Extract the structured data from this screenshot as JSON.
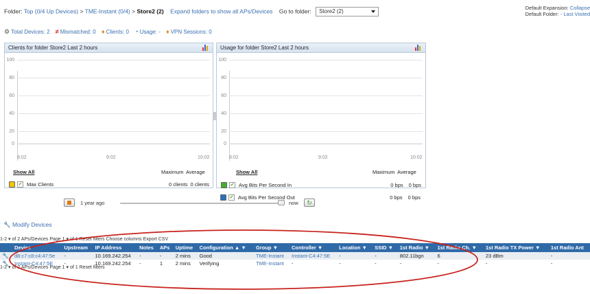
{
  "folder": {
    "label": "Folder:",
    "crumb_top": "Top (0/4 Up Devices)",
    "sep1": ">",
    "crumb_mid": "TME-Instant (0/4)",
    "sep2": ">",
    "current": "Store2 (2)",
    "expand_link": "Expand folders to show all APs/Devices",
    "goto_label": "Go to folder:",
    "goto_value": "Store2 (2)"
  },
  "defaults": {
    "expansion_label": "Default Expansion:",
    "expansion_value": "Collapse",
    "folder_label": "Default Folder:",
    "folder_value": "- Last Visited"
  },
  "stats": {
    "total": "Total Devices: 2",
    "mismatched": "Mismatched: 0",
    "clients": "Clients: 0",
    "usage": "Usage: -",
    "vpn": "VPN Sessions: 0"
  },
  "clients_panel": {
    "title": "Clients for folder Store2   Last 2 hours",
    "y_ticks": [
      "100",
      "80",
      "60",
      "40",
      "20",
      "0"
    ],
    "x_ticks": [
      "8:02",
      "9:02",
      "10:02"
    ],
    "show_all": "Show All",
    "col_max": "Maximum",
    "col_avg": "Average",
    "series": [
      {
        "name": "Max Clients",
        "max": "0 clients",
        "avg": "0 clients",
        "color": "#f2c500"
      }
    ]
  },
  "usage_panel": {
    "title": "Usage for folder Store2   Last 2 hours",
    "y_ticks": [
      "100",
      "80",
      "60",
      "40",
      "20",
      "0"
    ],
    "x_ticks": [
      "8:02",
      "9:02",
      "10:02"
    ],
    "show_all": "Show All",
    "col_max": "Maximum",
    "col_avg": "Average",
    "series": [
      {
        "name": "Avg Bits Per Second In",
        "max": "0 bps",
        "avg": "0 bps",
        "color": "#3fae2a"
      },
      {
        "name": "Avg Bits Per Second Out",
        "max": "0 bps",
        "avg": "0 bps",
        "color": "#2a6fbf"
      }
    ]
  },
  "timeline": {
    "start": "1 year ago",
    "end": "now"
  },
  "devices": {
    "title": "Modify Devices",
    "pager_top": "1-2 ▾ of 2 APs/Devices  Page 1 ▾ of 1 Reset filters   Choose columns   Export CSV",
    "pager_bottom": "1-2 ▾ of 2 APs/Devices  Page 1 ▾ of 1 Reset filters",
    "columns": [
      "",
      "Device",
      "Upstream",
      "IP Address",
      "Notes",
      "APs",
      "Uptime",
      "Configuration ▲ ▼",
      "Group ▼",
      "Controller ▼",
      "Location ▼",
      "SSID ▼",
      "1st Radio ▼",
      "1st Radio Ch. ▼",
      "1st Radio TX Power ▼",
      "1st Radio Ant"
    ],
    "rows": [
      [
        "",
        "d8:c7:c8:c4:47:5e",
        "-",
        "10.169.242.254",
        "-",
        "-",
        "2 mins",
        "Good",
        "TME-Instant",
        "Instant-C4:47:5E",
        "-",
        "-",
        "802.11bgn",
        "6",
        "23 dBm",
        "-"
      ],
      [
        "",
        "Instant-C4:47:5E",
        "-",
        "10.169.242.254",
        "-",
        "1",
        "2 mins",
        "Verifying",
        "TME-Instant",
        "-",
        "-",
        "-",
        "-",
        "-",
        "-",
        "-"
      ]
    ]
  }
}
